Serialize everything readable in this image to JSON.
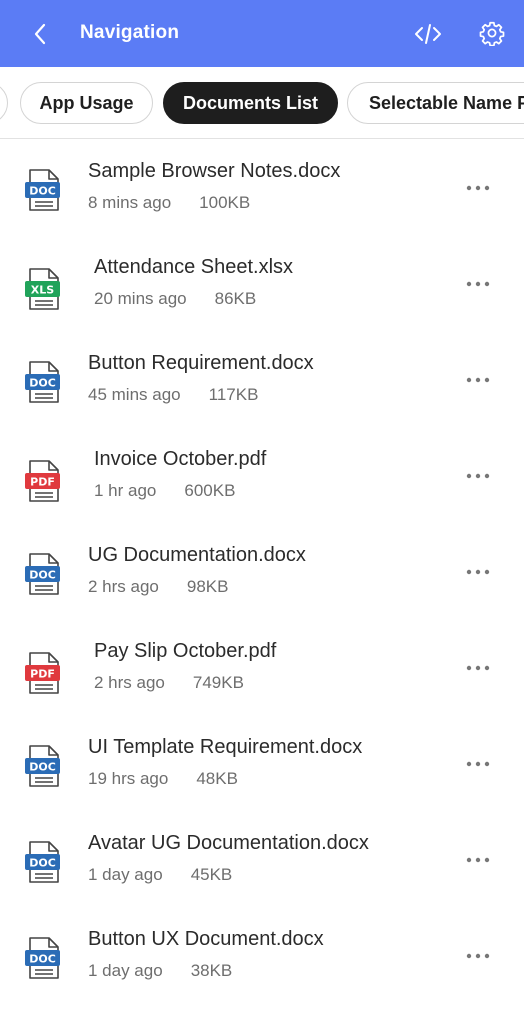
{
  "header": {
    "title": "Navigation",
    "background": "#5b7cf5",
    "icons": {
      "back": "chevron-left-icon",
      "code": "code-icon",
      "settings": "gear-icon"
    }
  },
  "tabs": [
    {
      "label": "App Usage",
      "selected": false
    },
    {
      "label": "Documents List",
      "selected": true
    },
    {
      "label": "Selectable Name P",
      "selected": false
    }
  ],
  "files": [
    {
      "name": "Sample Browser Notes.docx",
      "time": "8 mins ago",
      "size": "100KB",
      "type": "DOC"
    },
    {
      "name": "Attendance Sheet.xlsx",
      "time": "20 mins ago",
      "size": "86KB",
      "type": "XLS"
    },
    {
      "name": "Button Requirement.docx",
      "time": "45 mins ago",
      "size": "117KB",
      "type": "DOC"
    },
    {
      "name": "Invoice October.pdf",
      "time": "1 hr ago",
      "size": "600KB",
      "type": "PDF"
    },
    {
      "name": "UG Documentation.docx",
      "time": "2 hrs ago",
      "size": "98KB",
      "type": "DOC"
    },
    {
      "name": "Pay Slip October.pdf",
      "time": "2 hrs ago",
      "size": "749KB",
      "type": "PDF"
    },
    {
      "name": "UI Template Requirement.docx",
      "time": "19 hrs ago",
      "size": "48KB",
      "type": "DOC"
    },
    {
      "name": "Avatar UG Documentation.docx",
      "time": "1 day ago",
      "size": "45KB",
      "type": "DOC"
    },
    {
      "name": "Button UX Document.docx",
      "time": "1 day ago",
      "size": "38KB",
      "type": "DOC"
    }
  ],
  "type_colors": {
    "DOC": "#2b6cb6",
    "XLS": "#21a35a",
    "PDF": "#e0393e"
  }
}
